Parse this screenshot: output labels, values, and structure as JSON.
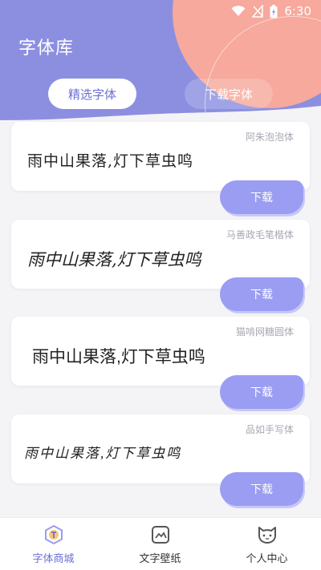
{
  "status_bar": {
    "time": "6:30",
    "icons": [
      "wifi-icon",
      "no-signal-icon",
      "battery-icon"
    ]
  },
  "header": {
    "title": "字体库"
  },
  "tabs": [
    {
      "label": "精选字体",
      "active": true
    },
    {
      "label": "下载字体",
      "active": false
    }
  ],
  "fonts": [
    {
      "name": "阿朱泡泡体",
      "sample": "雨中山果落,灯下草虫鸣",
      "button": "下载"
    },
    {
      "name": "马善政毛笔楷体",
      "sample": "雨中山果落,灯下草虫鸣",
      "button": "下载"
    },
    {
      "name": "猫啃网糖圆体",
      "sample": "雨中山果落,灯下草虫鸣",
      "button": "下载"
    },
    {
      "name": "品如手写体",
      "sample": "雨中山果落,灯下草虫鸣",
      "button": "下载"
    }
  ],
  "bottom_nav": [
    {
      "label": "字体商城",
      "icon": "font-store-icon",
      "active": true
    },
    {
      "label": "文字壁纸",
      "icon": "wallpaper-icon",
      "active": false
    },
    {
      "label": "个人中心",
      "icon": "cat-profile-icon",
      "active": false
    }
  ],
  "colors": {
    "accent": "#8c8fe0",
    "button": "#9a9df1",
    "blob": "#f6a99c"
  }
}
